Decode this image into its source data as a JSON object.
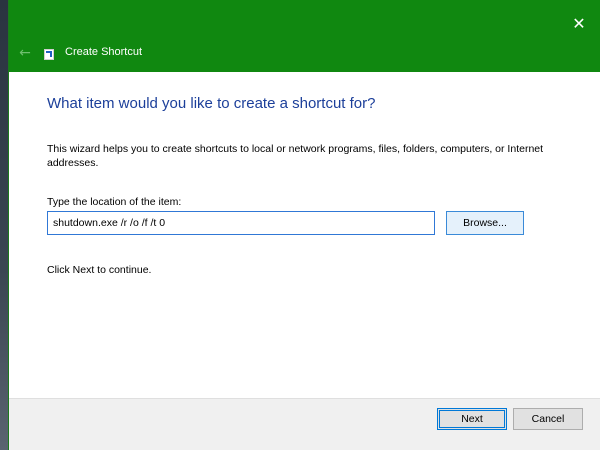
{
  "window": {
    "title": "Create Shortcut",
    "close_glyph": "✕",
    "back_glyph": "←",
    "titlebar_color": "#108810"
  },
  "content": {
    "heading": "What item would you like to create a shortcut for?",
    "description": "This wizard helps you to create shortcuts to local or network programs, files, folders, computers, or Internet addresses.",
    "location_label": "Type the location of the item:",
    "location_value": "shutdown.exe /r /o /f /t 0",
    "browse_label": "Browse...",
    "hint": "Click Next to continue."
  },
  "footer": {
    "next_label": "Next",
    "cancel_label": "Cancel"
  },
  "icons": {
    "close": "close-icon",
    "back": "back-arrow-icon",
    "app": "shortcut-icon"
  }
}
